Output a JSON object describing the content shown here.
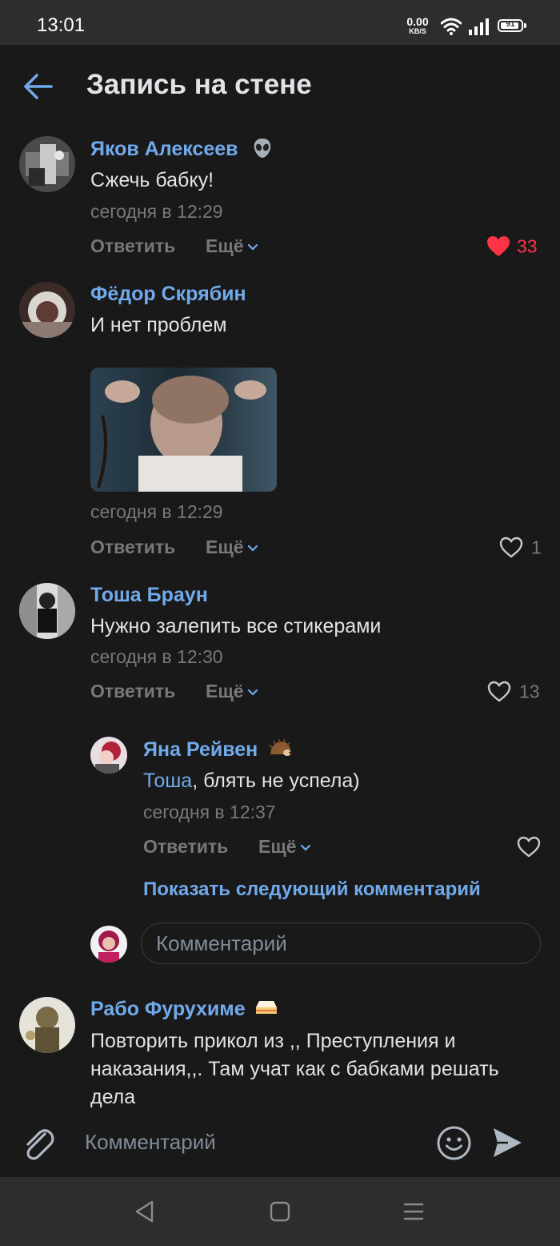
{
  "status_bar": {
    "time": "13:01",
    "net_speed_value": "0.00",
    "net_speed_unit": "KB/S",
    "battery": "91"
  },
  "header": {
    "title": "Запись на стене",
    "back_icon": "arrow-left-icon"
  },
  "comments": [
    {
      "author": "Яков Алексеев",
      "badge_icon": "alien-emoji-icon",
      "text": "Сжечь бабку!",
      "date": "сегодня в 12:29",
      "reply_label": "Ответить",
      "more_label": "Ещё",
      "likes": "33",
      "liked": true
    },
    {
      "author": "Фёдор Скрябин",
      "text": "И нет проблем",
      "has_photo": true,
      "date": "сегодня в 12:29",
      "reply_label": "Ответить",
      "more_label": "Ещё",
      "likes": "1",
      "liked": false
    },
    {
      "author": "Тоша Браун",
      "text": "Нужно залепить все стикерами",
      "date": "сегодня в 12:30",
      "reply_label": "Ответить",
      "more_label": "Ещё",
      "likes": "13",
      "liked": false
    },
    {
      "author": "Рабо Фурухиме",
      "badge_icon": "cake-emoji-icon",
      "text_line1": "Повторить прикол из ,, Преступления и",
      "text_line2": "наказания,,. Там учат как с бабками решать",
      "text_line3": "дела"
    }
  ],
  "reply": {
    "author": "Яна Рейвен",
    "badge_icon": "hedgehog-emoji-icon",
    "mention": "Тоша",
    "text": ", блять не успела)",
    "date": "сегодня в 12:37",
    "reply_label": "Ответить",
    "more_label": "Ещё",
    "liked": false
  },
  "show_next_label": "Показать следующий комментарий",
  "inline_comment_placeholder": "Комментарий",
  "bottom_bar": {
    "placeholder": "Комментарий",
    "attach_icon": "paperclip-icon",
    "emoji_icon": "smile-icon",
    "send_icon": "send-icon"
  },
  "nav_bar": {
    "back_icon": "nav-back-icon",
    "home_icon": "nav-home-icon",
    "menu_icon": "nav-menu-icon"
  },
  "colors": {
    "background": "#19191a",
    "accent": "#71aaeb",
    "secondary_text": "#76787a",
    "like_active": "#ff3347"
  }
}
